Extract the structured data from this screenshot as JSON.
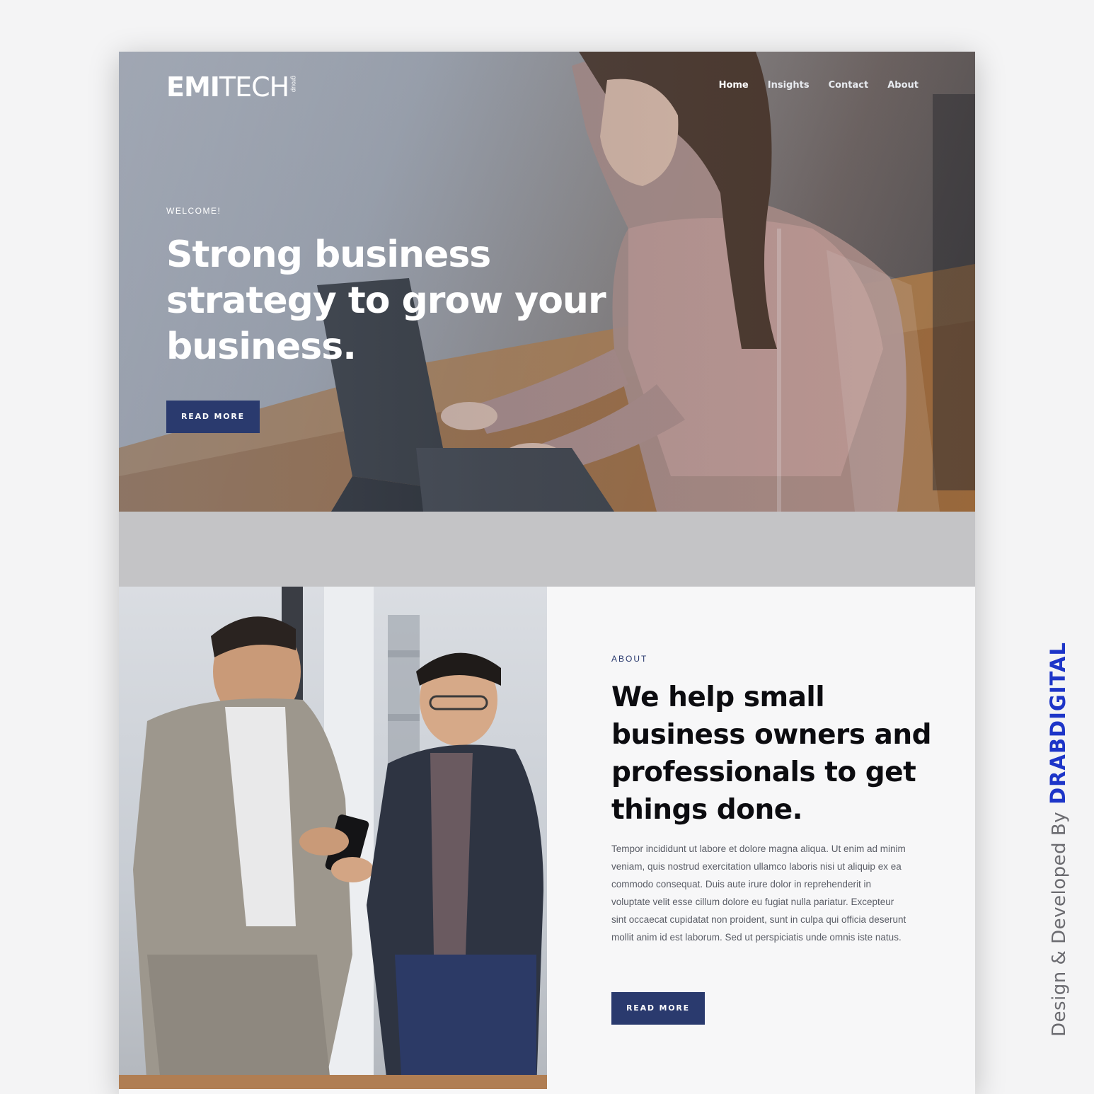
{
  "header": {
    "logo": {
      "main_bold": "EMI",
      "main_light": "TECH",
      "sub": "group"
    },
    "nav": [
      {
        "label": "Home"
      },
      {
        "label": "Insights"
      },
      {
        "label": "Contact"
      },
      {
        "label": "About"
      }
    ]
  },
  "hero": {
    "eyebrow": "WELCOME!",
    "title": "Strong business strategy to grow your business.",
    "button_label": "READ MORE"
  },
  "about": {
    "eyebrow": "ABOUT",
    "title": "We help small business owners and professionals to get things done.",
    "body": "Tempor incididunt ut labore et dolore magna aliqua. Ut enim ad minim veniam, quis nostrud exercitation ullamco laboris nisi ut aliquip ex ea commodo consequat. Duis aute irure dolor in reprehenderit in voluptate velit esse cillum dolore eu fugiat nulla pariatur. Excepteur sint occaecat cupidatat non proident, sunt in culpa qui officia deserunt mollit anim id est laborum. Sed ut perspiciatis unde omnis iste natus.",
    "button_label": "READ MORE"
  },
  "credit": {
    "label": "Design & Developed By",
    "brand": "DRABDIGITAL"
  },
  "colors": {
    "accent": "#2a3a6e",
    "brand_credit": "#1d35c8",
    "band": "#c4c4c6"
  }
}
